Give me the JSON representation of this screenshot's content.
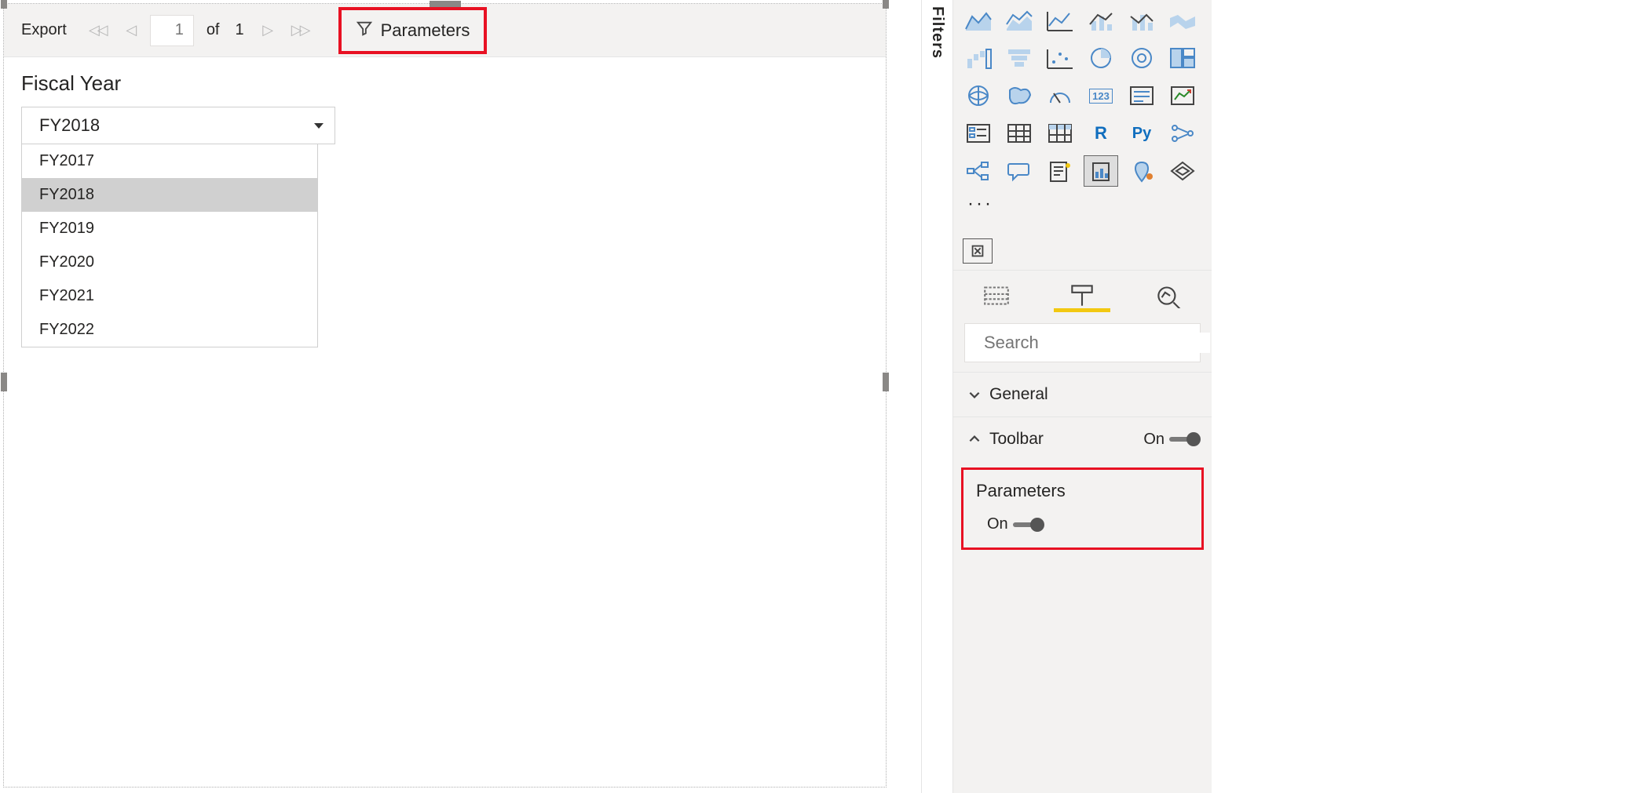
{
  "toolbar": {
    "export_label": "Export",
    "page_current": "1",
    "page_of": "of",
    "page_total": "1",
    "parameters_label": "Parameters"
  },
  "report": {
    "param_name": "Fiscal Year",
    "selected_value": "FY2018",
    "options": [
      "FY2017",
      "FY2018",
      "FY2019",
      "FY2020",
      "FY2021",
      "FY2022"
    ]
  },
  "panels": {
    "filters": "Filters"
  },
  "viz_palette": {
    "more": "···",
    "r": "R",
    "py": "Py",
    "num": "123"
  },
  "search": {
    "placeholder": "Search"
  },
  "format": {
    "general": "General",
    "toolbar": "Toolbar",
    "toolbar_state": "On",
    "parameters": "Parameters",
    "parameters_state": "On"
  }
}
